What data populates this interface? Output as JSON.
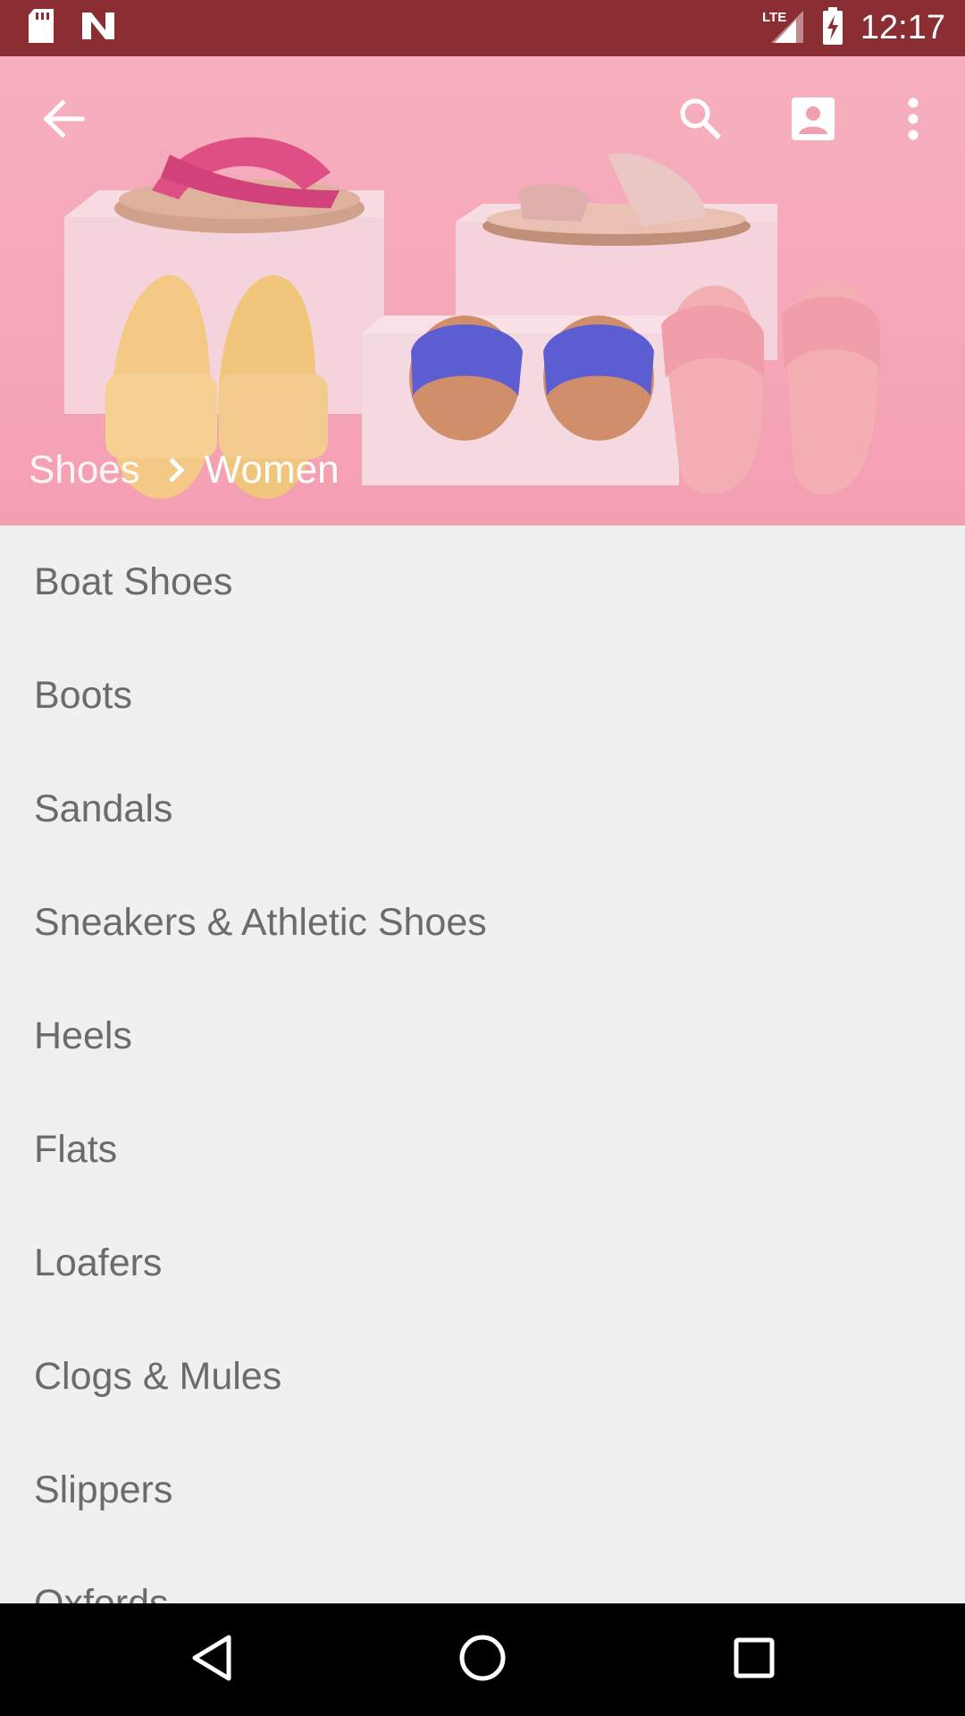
{
  "status_bar": {
    "time": "12:17",
    "network": "LTE",
    "icons": [
      "sd-card-icon",
      "n-notification-icon",
      "lte-signal-icon",
      "battery-charging-icon"
    ]
  },
  "toolbar": {
    "back_icon": "arrow-left-icon",
    "search_icon": "search-icon",
    "account_icon": "account-box-icon",
    "more_icon": "more-vertical-icon"
  },
  "breadcrumb": {
    "parent": "Shoes",
    "current": "Women"
  },
  "categories": [
    "Boat Shoes",
    "Boots",
    "Sandals",
    "Sneakers & Athletic Shoes",
    "Heels",
    "Flats",
    "Loafers",
    "Clogs & Mules",
    "Slippers",
    "Oxfords"
  ],
  "colors": {
    "status_bar": "#8a2e33",
    "hero_pink": "#f7b3c0",
    "list_background": "#f0f0f0",
    "list_text": "#6b6b6b",
    "nav_bar": "#000000"
  },
  "nav_bar": {
    "back_icon": "nav-back-icon",
    "home_icon": "nav-home-icon",
    "recents_icon": "nav-recents-icon"
  }
}
